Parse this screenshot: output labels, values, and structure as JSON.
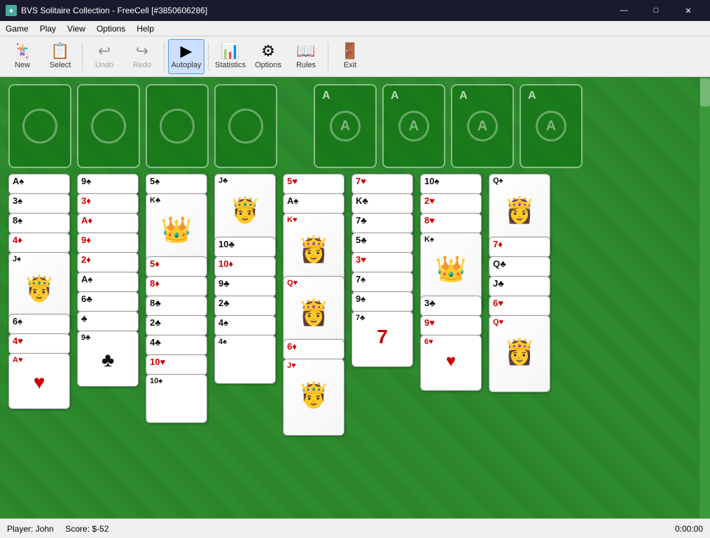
{
  "window": {
    "title": "BVS Solitaire Collection - FreeCell [#3850606286]",
    "icon": "♠"
  },
  "titlebar": {
    "minimize_label": "—",
    "maximize_label": "□",
    "close_label": "✕"
  },
  "menubar": {
    "items": [
      "Game",
      "Play",
      "View",
      "Options",
      "Help"
    ]
  },
  "toolbar": {
    "buttons": [
      {
        "id": "new",
        "label": "New",
        "icon": "🃏",
        "active": false,
        "disabled": false
      },
      {
        "id": "select",
        "label": "Select",
        "icon": "📋",
        "active": false,
        "disabled": false
      },
      {
        "id": "undo",
        "label": "Undo",
        "icon": "↩",
        "active": false,
        "disabled": true
      },
      {
        "id": "redo",
        "label": "Redo",
        "icon": "↪",
        "active": false,
        "disabled": true
      },
      {
        "id": "autoplay",
        "label": "Autoplay",
        "icon": "▶",
        "active": true,
        "disabled": false
      },
      {
        "id": "statistics",
        "label": "Statistics",
        "icon": "📊",
        "active": false,
        "disabled": false
      },
      {
        "id": "options",
        "label": "Options",
        "icon": "⚙",
        "active": false,
        "disabled": false
      },
      {
        "id": "rules",
        "label": "Rules",
        "icon": "📖",
        "active": false,
        "disabled": false
      },
      {
        "id": "exit",
        "label": "Exit",
        "icon": "🚪",
        "active": false,
        "disabled": false
      }
    ]
  },
  "freecells": [
    {
      "id": "fc1",
      "card": null
    },
    {
      "id": "fc2",
      "card": null
    },
    {
      "id": "fc3",
      "card": null
    },
    {
      "id": "fc4",
      "card": null
    }
  ],
  "foundations": [
    {
      "id": "f1",
      "label": "A",
      "suit": "♠"
    },
    {
      "id": "f2",
      "label": "A",
      "suit": "♥"
    },
    {
      "id": "f3",
      "label": "A",
      "suit": "♦"
    },
    {
      "id": "f4",
      "label": "A",
      "suit": "♣"
    }
  ],
  "columns": [
    {
      "id": "col1",
      "cards": [
        {
          "rank": "A",
          "suit": "♠",
          "color": "black"
        },
        {
          "rank": "3",
          "suit": "♠",
          "color": "black"
        },
        {
          "rank": "8",
          "suit": "♠",
          "color": "black"
        },
        {
          "rank": "4",
          "suit": "♦",
          "color": "red"
        },
        {
          "rank": "J",
          "suit": "",
          "color": "black",
          "face": true
        },
        {
          "rank": "6",
          "suit": "♠",
          "color": "black"
        },
        {
          "rank": "4",
          "suit": "♥",
          "color": "red"
        },
        {
          "rank": "A",
          "suit": "♥",
          "color": "red",
          "last": true
        }
      ]
    },
    {
      "id": "col2",
      "cards": [
        {
          "rank": "9",
          "suit": "♠",
          "color": "black"
        },
        {
          "rank": "3",
          "suit": "♦",
          "color": "red"
        },
        {
          "rank": "A",
          "suit": "♦",
          "color": "red"
        },
        {
          "rank": "9",
          "suit": "♦",
          "color": "red"
        },
        {
          "rank": "2",
          "suit": "♦",
          "color": "red"
        },
        {
          "rank": "A",
          "suit": "♠",
          "color": "black"
        },
        {
          "rank": "6",
          "suit": "♣",
          "color": "black"
        },
        {
          "rank": "♣",
          "suit": "",
          "color": "black"
        },
        {
          "rank": "9",
          "suit": "♣",
          "color": "black",
          "last": true
        }
      ]
    },
    {
      "id": "col3",
      "cards": [
        {
          "rank": "5",
          "suit": "♠",
          "color": "black"
        },
        {
          "rank": "K",
          "suit": "",
          "color": "black",
          "face": true
        },
        {
          "rank": "5",
          "suit": "♦",
          "color": "red"
        },
        {
          "rank": "8",
          "suit": "♦",
          "color": "red"
        },
        {
          "rank": "8",
          "suit": "♣",
          "color": "black"
        },
        {
          "rank": "2",
          "suit": "♣",
          "color": "black"
        },
        {
          "rank": "4",
          "suit": "♣",
          "color": "black"
        },
        {
          "rank": "10",
          "suit": "♥",
          "color": "red"
        },
        {
          "rank": "10",
          "suit": "♠",
          "color": "black",
          "last": true
        }
      ]
    },
    {
      "id": "col4",
      "cards": [
        {
          "rank": "J",
          "suit": "",
          "color": "black",
          "face": true
        },
        {
          "rank": "10",
          "suit": "♣",
          "color": "black"
        },
        {
          "rank": "10",
          "suit": "♦",
          "color": "red"
        },
        {
          "rank": "9",
          "suit": "♣",
          "color": "black"
        },
        {
          "rank": "2",
          "suit": "♣",
          "color": "black"
        },
        {
          "rank": "4",
          "suit": "♠",
          "color": "black"
        },
        {
          "rank": "4",
          "suit": "♠",
          "color": "black",
          "last": true
        }
      ]
    },
    {
      "id": "col5",
      "cards": [
        {
          "rank": "5",
          "suit": "♥",
          "color": "red"
        },
        {
          "rank": "A",
          "suit": "♠",
          "color": "black"
        },
        {
          "rank": "K",
          "suit": "",
          "color": "red",
          "face": true
        },
        {
          "rank": "Q",
          "suit": "",
          "color": "red",
          "face": true
        },
        {
          "rank": "6",
          "suit": "♦",
          "color": "red"
        },
        {
          "rank": "J",
          "suit": "",
          "color": "red",
          "face": true,
          "last": true
        }
      ]
    },
    {
      "id": "col6",
      "cards": [
        {
          "rank": "7",
          "suit": "♥",
          "color": "red"
        },
        {
          "rank": "K",
          "suit": "♣",
          "color": "black"
        },
        {
          "rank": "7",
          "suit": "♣",
          "color": "black"
        },
        {
          "rank": "5",
          "suit": "♣",
          "color": "black"
        },
        {
          "rank": "3",
          "suit": "♥",
          "color": "red"
        },
        {
          "rank": "7",
          "suit": "♠",
          "color": "black"
        },
        {
          "rank": "9",
          "suit": "♠",
          "color": "black"
        },
        {
          "rank": "7",
          "suit": "♣",
          "color": "black",
          "last": true
        }
      ]
    },
    {
      "id": "col7",
      "cards": [
        {
          "rank": "10",
          "suit": "♠",
          "color": "black"
        },
        {
          "rank": "2",
          "suit": "♥",
          "color": "red"
        },
        {
          "rank": "8",
          "suit": "♥",
          "color": "red"
        },
        {
          "rank": "K",
          "suit": "",
          "color": "black",
          "face": true
        },
        {
          "rank": "3",
          "suit": "♣",
          "color": "black"
        },
        {
          "rank": "9",
          "suit": "♥",
          "color": "red"
        },
        {
          "rank": "6",
          "suit": "♥",
          "color": "red",
          "last": true
        }
      ]
    },
    {
      "id": "col8",
      "cards": [
        {
          "rank": "Q",
          "suit": "",
          "color": "black",
          "face": true
        },
        {
          "rank": "7",
          "suit": "♦",
          "color": "red"
        },
        {
          "rank": "Q",
          "suit": "♣",
          "color": "black"
        },
        {
          "rank": "J",
          "suit": "♣",
          "color": "black"
        },
        {
          "rank": "6",
          "suit": "♥",
          "color": "red"
        },
        {
          "rank": "Q",
          "suit": "",
          "color": "red",
          "face": true,
          "last": true
        }
      ]
    }
  ],
  "statusbar": {
    "player": "Player: John",
    "score": "Score: $-52",
    "timer": "0:00:00"
  }
}
